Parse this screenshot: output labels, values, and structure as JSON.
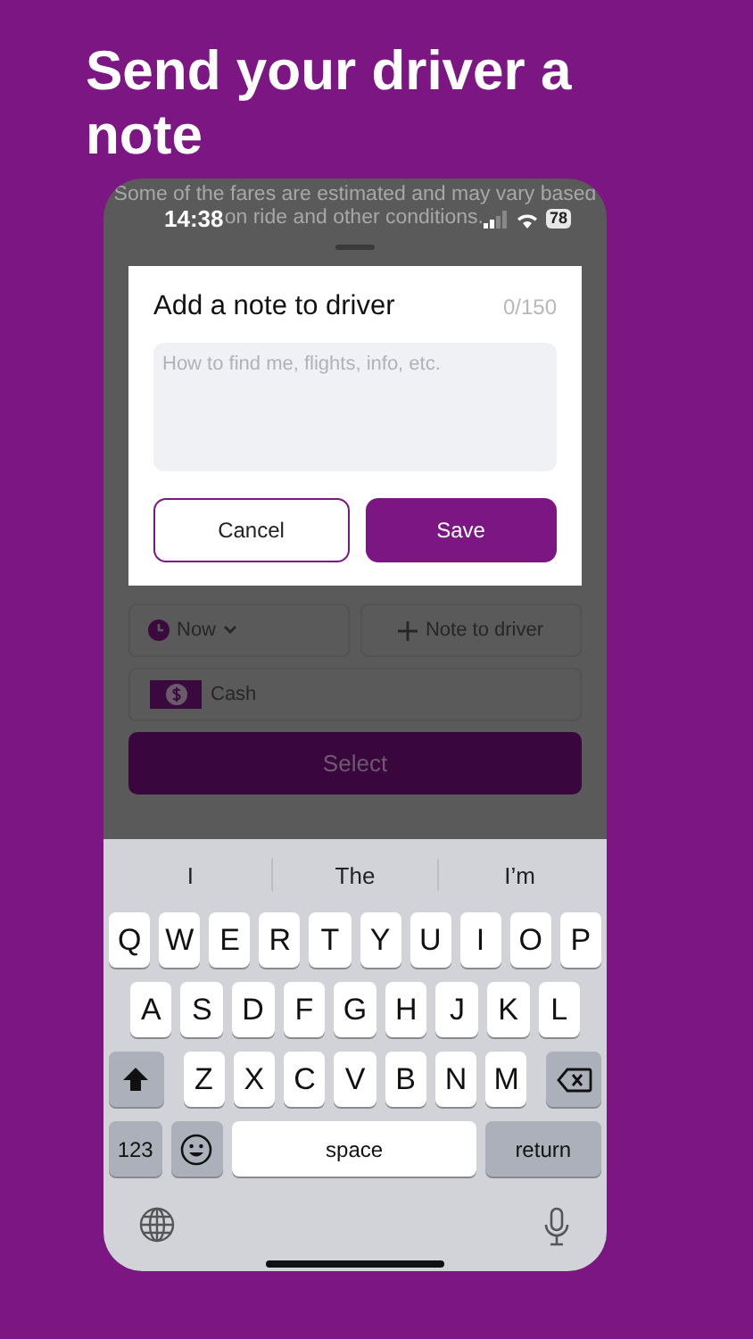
{
  "headline": "Send your driver a note",
  "disclaimer": [
    "Some of the fares are estimated and may vary based",
    "on ride and other conditions."
  ],
  "status_bar": {
    "time": "14:38",
    "battery": "78"
  },
  "dialog": {
    "title": "Add a note to driver",
    "counter": "0/150",
    "note_field": {
      "placeholder": "How to find me, flights, info, etc."
    },
    "buttons": [
      {
        "label": "Cancel",
        "kind": "outline"
      },
      {
        "label": "Save",
        "kind": "filled"
      }
    ]
  },
  "trip_options": {
    "time_button": "Now",
    "note_button": "Note to driver",
    "payment": "Cash",
    "primary_button": "Select"
  },
  "keyboard": {
    "suggestions": [
      "I",
      "The",
      "I’m"
    ],
    "rows": [
      [
        "Q",
        "W",
        "E",
        "R",
        "T",
        "Y",
        "U",
        "I",
        "O",
        "P"
      ],
      [
        "A",
        "S",
        "D",
        "F",
        "G",
        "H",
        "J",
        "K",
        "L"
      ],
      [
        "Z",
        "X",
        "C",
        "V",
        "B",
        "N",
        "M"
      ]
    ],
    "numbers_key": "123",
    "space_key": "space",
    "return_key": "return"
  }
}
